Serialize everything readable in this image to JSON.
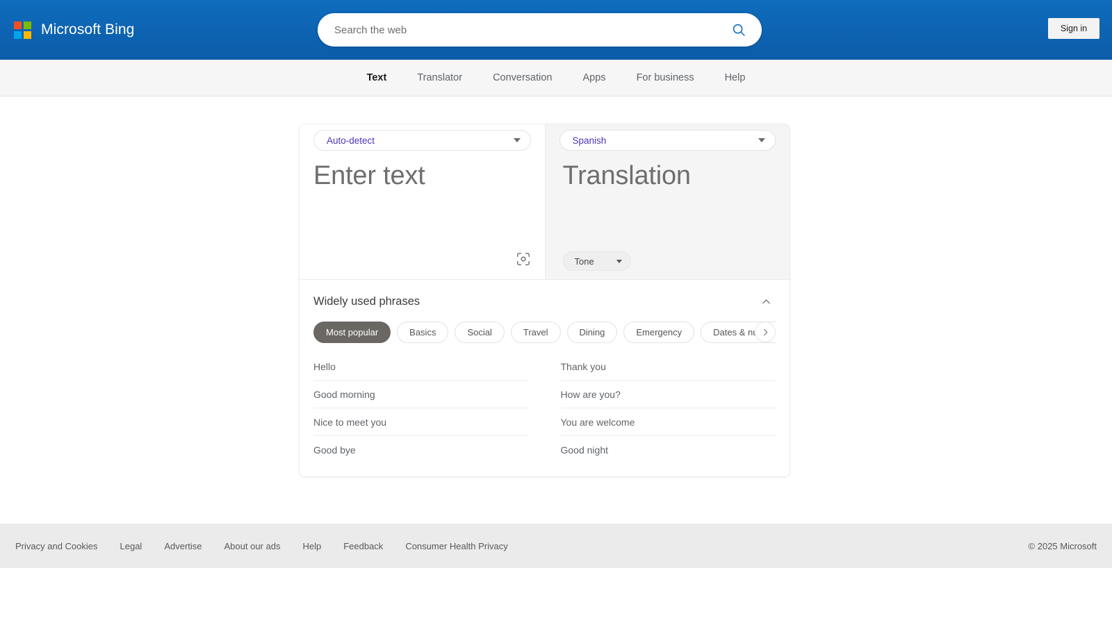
{
  "header": {
    "brand": "Microsoft Bing",
    "logo_icon": "microsoft-logo-icon",
    "signin_label": "Sign in"
  },
  "search": {
    "placeholder": "Search the web",
    "value": "",
    "icon": "search-icon"
  },
  "nav": {
    "items": [
      {
        "label": "Text",
        "active": true
      },
      {
        "label": "Translator",
        "active": false
      },
      {
        "label": "Conversation",
        "active": false
      },
      {
        "label": "Apps",
        "active": false
      },
      {
        "label": "For business",
        "active": false
      },
      {
        "label": "Help",
        "active": false
      }
    ]
  },
  "translator": {
    "source_language": "Auto-detect",
    "target_language": "Spanish",
    "swap_icon": "swap-arrows-icon",
    "source_placeholder": "Enter text",
    "target_placeholder": "Translation",
    "scan_icon": "camera-scan-icon",
    "tone_label": "Tone",
    "tone_caret_icon": "chevron-down-icon"
  },
  "phrases": {
    "title": "Widely used phrases",
    "collapse_icon": "chevron-up-icon",
    "next_icon": "chevron-right-icon",
    "categories": [
      {
        "label": "Most popular",
        "selected": true
      },
      {
        "label": "Basics",
        "selected": false
      },
      {
        "label": "Social",
        "selected": false
      },
      {
        "label": "Travel",
        "selected": false
      },
      {
        "label": "Dining",
        "selected": false
      },
      {
        "label": "Emergency",
        "selected": false
      },
      {
        "label": "Dates & numbers",
        "selected": false
      }
    ],
    "column_left": [
      "Hello",
      "Good morning",
      "Nice to meet you",
      "Good bye"
    ],
    "column_right": [
      "Thank you",
      "How are you?",
      "You are welcome",
      "Good night"
    ]
  },
  "footer": {
    "links": [
      "Privacy and Cookies",
      "Legal",
      "Advertise",
      "About our ads",
      "Help",
      "Feedback",
      "Consumer Health Privacy"
    ],
    "copyright": "© 2025 Microsoft"
  },
  "colors": {
    "header_gradient_top": "#0f6cbd",
    "header_gradient_bottom": "#0c5ca8",
    "language_text": "#4b37b8",
    "chip_selected_bg": "#6b6864",
    "footer_bg": "#ebebeb"
  }
}
